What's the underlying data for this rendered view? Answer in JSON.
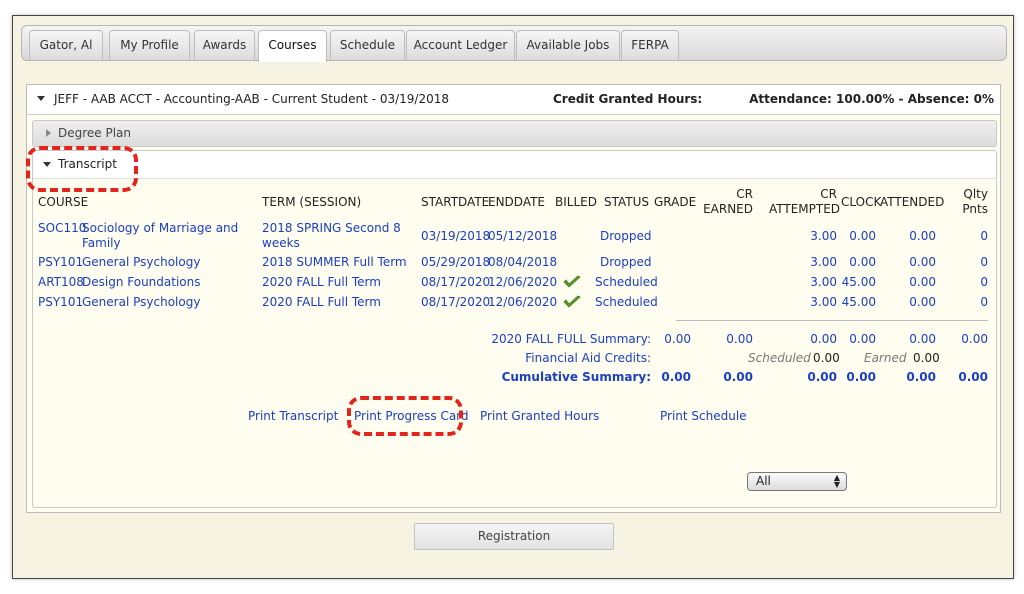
{
  "tabs": [
    "Gator, Al",
    "My Profile",
    "Awards",
    "Courses",
    "Schedule",
    "Account Ledger",
    "Available Jobs",
    "FERPA"
  ],
  "program": {
    "title": "JEFF - AAB ACCT - Accounting-AAB - Current Student - 03/19/2018",
    "credit_label": "Credit Granted Hours:",
    "attendance": "Attendance: 100.00% - Absence: 0%"
  },
  "degree_plan_label": "Degree Plan",
  "transcript_label": "Transcript",
  "columns": {
    "course": "COURSE",
    "term": "TERM (SESSION)",
    "startdate": "STARTDATE",
    "enddate": "ENDDATE",
    "billed": "BILLED",
    "status": "STATUS",
    "grade": "GRADE",
    "cr_earned_1": "CR",
    "cr_earned_2": "EARNED",
    "cr_attempted_1": "CR",
    "cr_attempted_2": "ATTEMPTED",
    "clock": "CLOCK",
    "attended": "ATTENDED",
    "qlty_1": "Qlty",
    "qlty_2": "Pnts"
  },
  "rows": [
    {
      "code": "SOC110",
      "name_1": "Sociology of Marriage and",
      "name_2": "Family",
      "term_1": "2018 SPRING Second 8",
      "term_2": "weeks",
      "start": "03/19/2018",
      "end": "05/12/2018",
      "billed": false,
      "status": "Dropped",
      "grade": "",
      "earned": "",
      "attempted": "3.00",
      "clock": "0.00",
      "attended": "0.00",
      "qlty": "0"
    },
    {
      "code": "PSY101",
      "name_1": "General Psychology",
      "name_2": "",
      "term_1": "2018 SUMMER Full Term",
      "term_2": "",
      "start": "05/29/2018",
      "end": "08/04/2018",
      "billed": false,
      "status": "Dropped",
      "grade": "",
      "earned": "",
      "attempted": "3.00",
      "clock": "0.00",
      "attended": "0.00",
      "qlty": "0"
    },
    {
      "code": "ART108",
      "name_1": "Design Foundations",
      "name_2": "",
      "term_1": "2020 FALL Full Term",
      "term_2": "",
      "start": "08/17/2020",
      "end": "12/06/2020",
      "billed": true,
      "status": "Scheduled",
      "grade": "",
      "earned": "",
      "attempted": "3.00",
      "clock": "45.00",
      "attended": "0.00",
      "qlty": "0"
    },
    {
      "code": "PSY101",
      "name_1": "General Psychology",
      "name_2": "",
      "term_1": "2020 FALL Full Term",
      "term_2": "",
      "start": "08/17/2020",
      "end": "12/06/2020",
      "billed": true,
      "status": "Scheduled",
      "grade": "",
      "earned": "",
      "attempted": "3.00",
      "clock": "45.00",
      "attended": "0.00",
      "qlty": "0"
    }
  ],
  "summary": {
    "term_label": "2020 FALL FULL Summary:",
    "term_values": [
      "0.00",
      "0.00",
      "0.00",
      "0.00",
      "0.00",
      "0.00"
    ],
    "aid_label": "Financial Aid Credits:",
    "aid_scheduled_label": "Scheduled",
    "aid_scheduled": "0.00",
    "aid_earned_label": "Earned",
    "aid_earned": "0.00",
    "cum_label": "Cumulative Summary:",
    "cum_values": [
      "0.00",
      "0.00",
      "0.00",
      "0.00",
      "0.00",
      "0.00"
    ]
  },
  "links": {
    "print_transcript": "Print Transcript",
    "print_progress": "Print Progress Card",
    "print_granted": "Print Granted Hours",
    "print_schedule": "Print Schedule"
  },
  "schedule_select": {
    "value": "All"
  },
  "registration_label": "Registration",
  "colors": {
    "link": "#1b3fbf",
    "highlight": "#e3241b",
    "check": "#5aa02c"
  }
}
